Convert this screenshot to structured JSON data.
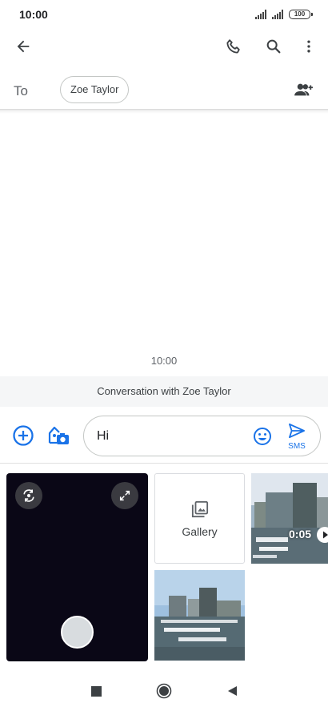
{
  "status_bar": {
    "time": "10:00",
    "battery": "100"
  },
  "recipient": {
    "to_label": "To",
    "chip": "Zoe Taylor"
  },
  "conversation": {
    "timestamp": "10:00",
    "banner": "Conversation with Zoe Taylor"
  },
  "compose": {
    "text": "Hi",
    "send_label": "SMS"
  },
  "media": {
    "gallery_label": "Gallery",
    "video_duration": "0:05"
  },
  "colors": {
    "accent": "#1a73e8",
    "icon": "#3c4043",
    "camera_bg": "#0a0716"
  },
  "icons": {
    "back": "arrow-left-icon",
    "call": "phone-icon",
    "search": "search-icon",
    "more": "more-vert-icon",
    "add_people": "person-add-icon",
    "attach": "plus-circle-icon",
    "gallery_camera": "image-camera-icon",
    "emoji": "smiley-icon",
    "send": "send-icon",
    "switch_camera": "switch-camera-icon",
    "fullscreen": "expand-icon",
    "gallery": "photo-library-icon",
    "play": "play-icon",
    "recents": "square-icon",
    "home": "circle-icon",
    "back_nav": "triangle-back-icon"
  }
}
